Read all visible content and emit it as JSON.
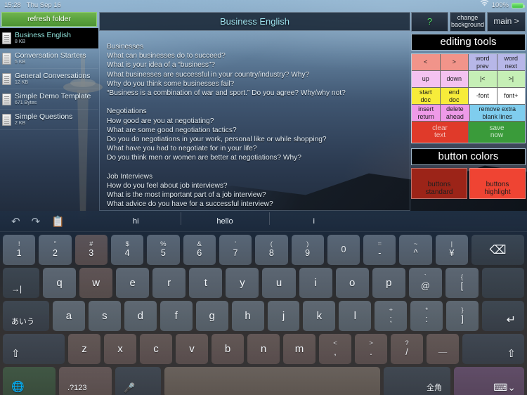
{
  "statusbar": {
    "time": "15:28",
    "date": "Thu Sep 16",
    "wifi_icon": "wifi-icon",
    "battery": "100%"
  },
  "sidebar": {
    "refresh_label": "refresh folder",
    "files": [
      {
        "name": "Business English",
        "size": "8 KB",
        "selected": true
      },
      {
        "name": "Conversation Starters",
        "size": "5 KB",
        "selected": false
      },
      {
        "name": "General Conversations",
        "size": "12 KB",
        "selected": false
      },
      {
        "name": "Simple Demo Template",
        "size": "671 Bytes",
        "selected": false
      },
      {
        "name": "Simple Questions",
        "size": "2 KB",
        "selected": false
      }
    ]
  },
  "document": {
    "title": "Business English",
    "text": "Businesses\nWhat can businesses do to succeed?\nWhat is your idea of a “business”?\nWhat businesses are successful in your country/industry? Why?\nWhy do you think some businesses fail?\n“Business is a combination of war and sport.” Do you agree? Why/why not?\n\nNegotiations\nHow good are you at negotiating?\nWhat are some good negotiation tactics?\nDo you do negotiations in your work, personal like or while shopping?\nWhat have you had to negotiate for in your life?\nDo you think men or women are better at negotiations? Why?\n\nJob Interviews\nHow do you feel about job interviews?\nWhat is the most important part of a job interview?\nWhat advice do you have for a successful interview?\nWhat questions are common in job interviews in your company/industry/country?\nWhat was the worst interview you have ever had?\n\nWorking Abroad\nHave you ever worked in another country?\nWhat difficulties can working abroad have?"
  },
  "tools": {
    "help_label": "?",
    "change_background_label": "change\nbackground",
    "main_label": "main >",
    "editing_tools_title": "editing tools",
    "rows": [
      [
        {
          "label": "<",
          "color": "c-salmon"
        },
        {
          "label": ">",
          "color": "c-salmon"
        },
        {
          "label": "word\nprev",
          "color": "c-periwinkle"
        },
        {
          "label": "word\nnext",
          "color": "c-periwinkle"
        }
      ],
      [
        {
          "label": "up",
          "color": "c-pink"
        },
        {
          "label": "down",
          "color": "c-pink"
        },
        {
          "label": "|<",
          "color": "c-green"
        },
        {
          "label": ">|",
          "color": "c-green"
        }
      ],
      [
        {
          "label": "start\ndoc",
          "color": "c-yellow"
        },
        {
          "label": "end\ndoc",
          "color": "c-yellow"
        },
        {
          "label": "-font",
          "color": "c-white"
        },
        {
          "label": "font+",
          "color": "c-white"
        }
      ],
      [
        {
          "label": "insert\nreturn",
          "color": "c-magenta"
        },
        {
          "label": "delete\nahead",
          "color": "c-magenta"
        },
        {
          "label": "remove extra\nblank lines",
          "color": "c-skyblue",
          "wide": true
        }
      ],
      [
        {
          "label": "clear\ntext",
          "color": "c-red",
          "wide": true,
          "tall": true
        },
        {
          "label": "save\nnow",
          "color": "c-darkgreen",
          "wide": true,
          "tall": true
        }
      ]
    ],
    "button_colors_title": "button colors",
    "swatches": [
      {
        "label": "buttons\nstandard",
        "class": "sw-standard",
        "hex": "#9c2418"
      },
      {
        "label": "buttons\nhighlight",
        "class": "sw-highlight",
        "hex": "#ef4433"
      }
    ]
  },
  "keyboard": {
    "undo_icon": "undo-icon",
    "redo_icon": "redo-icon",
    "paste_icon": "clipboard-icon",
    "suggestions": [
      "hi",
      "hello",
      "i"
    ],
    "row_numbers": [
      {
        "sup": "!",
        "sub": "1"
      },
      {
        "sup": "”",
        "sub": "2"
      },
      {
        "sup": "#",
        "sub": "3"
      },
      {
        "sup": "$",
        "sub": "4"
      },
      {
        "sup": "%",
        "sub": "5"
      },
      {
        "sup": "&",
        "sub": "6"
      },
      {
        "sup": "’",
        "sub": "7"
      },
      {
        "sup": "(",
        "sub": "8"
      },
      {
        "sup": ")",
        "sub": "9"
      },
      {
        "sup": "",
        "sub": "0"
      },
      {
        "sup": "=",
        "sub": "-"
      },
      {
        "sup": "~",
        "sub": "^"
      },
      {
        "sup": "|",
        "sub": "¥"
      }
    ],
    "backspace_label": "⌫",
    "tab_label": "→|",
    "row_q": [
      "q",
      "w",
      "e",
      "r",
      "t",
      "y",
      "u",
      "i",
      "o",
      "p"
    ],
    "row_q_extra": [
      {
        "sup": "`",
        "sub": "@"
      },
      {
        "sup": "{",
        "sub": "["
      }
    ],
    "kana_label": "あいう",
    "row_a": [
      "a",
      "s",
      "d",
      "f",
      "g",
      "h",
      "j",
      "k",
      "l"
    ],
    "row_a_extra": [
      {
        "sup": "+",
        "sub": ";"
      },
      {
        "sup": "*",
        "sub": ":"
      },
      {
        "sup": "}",
        "sub": "]"
      }
    ],
    "enter_label": "↵",
    "shift_label": "⇧",
    "row_z": [
      "z",
      "x",
      "c",
      "v",
      "b",
      "n",
      "m"
    ],
    "row_z_extra": [
      {
        "sup": "<",
        "sub": ","
      },
      {
        "sup": ">",
        "sub": "."
      },
      {
        "sup": "?",
        "sub": "/"
      },
      {
        "sup": "",
        "sub": "＿"
      }
    ],
    "globe_label": "⊕",
    "numeric_label": ".?123",
    "mic_label": "ᵢ",
    "space_label": "",
    "zenkaku_label": "全角",
    "hide_keyboard_label": "keyboard-hide-icon"
  }
}
